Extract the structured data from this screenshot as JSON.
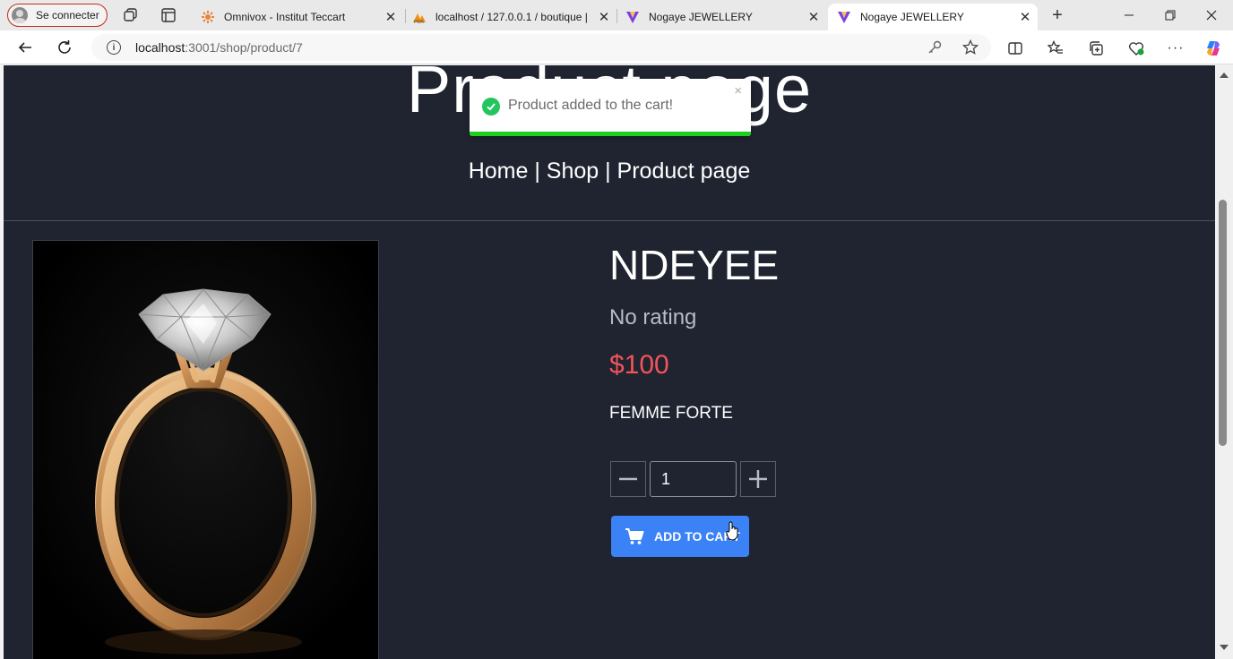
{
  "browser": {
    "profile_label": "Se connecter",
    "tabs": [
      {
        "title": "Omnivox - Institut Teccart",
        "icon": "omnivox-icon",
        "active": false
      },
      {
        "title": "localhost / 127.0.0.1 / boutique |",
        "icon": "phpmyadmin-icon",
        "active": false
      },
      {
        "title": "Nogaye JEWELLERY",
        "icon": "nogaye-logo-icon",
        "active": false
      },
      {
        "title": "Nogaye JEWELLERY",
        "icon": "nogaye-logo-icon",
        "active": true
      }
    ],
    "address": {
      "host": "localhost",
      "path": ":3001/shop/product/7"
    }
  },
  "page": {
    "hero_title": "Product page",
    "breadcrumb": "Home | Shop | Product page"
  },
  "product": {
    "name": "NDEYEE",
    "rating": "No rating",
    "price": "$100",
    "description": "FEMME FORTE",
    "quantity": "1",
    "add_to_cart_label": "ADD TO CART"
  },
  "toast": {
    "message": "Product added to the cart!",
    "close": "×",
    "progress_fraction": 1.0
  },
  "colors": {
    "page_bg": "#1f2430",
    "price": "#f2545b",
    "button": "#3b82f6",
    "toast_success": "#22c55e"
  }
}
